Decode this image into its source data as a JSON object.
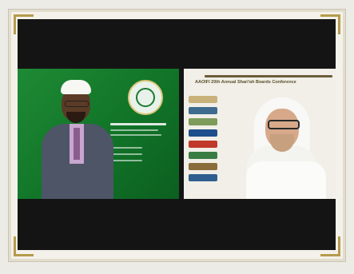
{
  "window": {
    "title": ""
  },
  "participants": [
    {
      "name": "speaker-left"
    },
    {
      "name": "speaker-right"
    }
  ],
  "left_slide": {
    "nametag": ""
  },
  "right_slide": {
    "conference_title": "AAOIFI 20th Annual Shari'ah Boards Conference"
  },
  "colors": {
    "slide_green": "#1e8a34",
    "frame_gold": "#b69b4c"
  }
}
